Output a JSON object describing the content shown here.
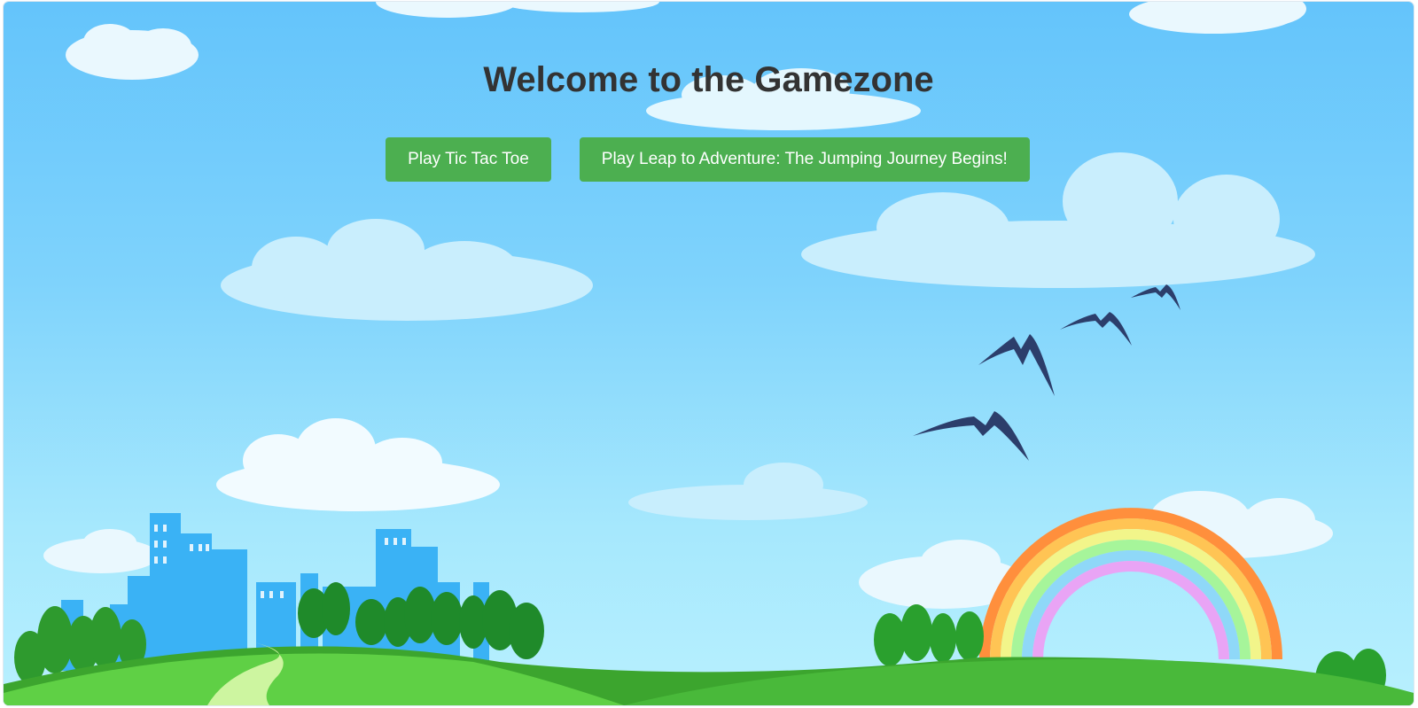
{
  "page": {
    "title": "Welcome to the Gamezone"
  },
  "buttons": {
    "tic_tac_toe": "Play Tic Tac Toe",
    "leap_adventure": "Play Leap to Adventure: The Jumping Journey Begins!"
  },
  "colors": {
    "sky_top": "#64c4fb",
    "sky_bottom": "#b8f0fe",
    "button": "#4caf50",
    "title_text": "#333333",
    "hill": "#4ebf3a",
    "city": "#3ab2f5"
  },
  "icons": [
    "cloud",
    "bird",
    "rainbow",
    "tree",
    "city-skyline",
    "hill"
  ]
}
